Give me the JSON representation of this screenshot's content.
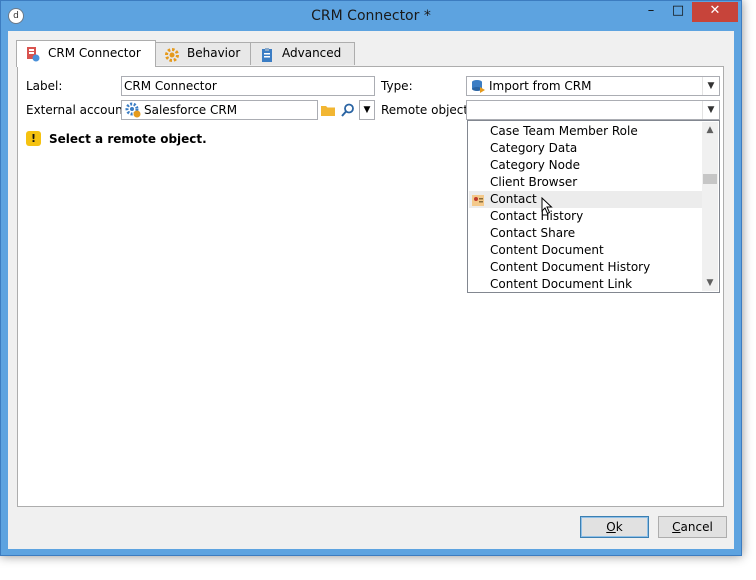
{
  "window": {
    "title": "CRM Connector *"
  },
  "title_buttons": {
    "minimize": "–",
    "maximize": "□",
    "close": "✕"
  },
  "tabs": [
    {
      "label": "CRM Connector",
      "icon": "crm-connector-icon",
      "active": true
    },
    {
      "label": "Behavior",
      "icon": "gear-icon",
      "active": false
    },
    {
      "label": "Advanced",
      "icon": "clipboard-icon",
      "active": false
    }
  ],
  "form": {
    "label_caption": "Label:",
    "label_value": "CRM Connector",
    "type_caption": "Type:",
    "type_value": "Import from CRM",
    "external_account_caption": "External account:",
    "external_account_value": "Salesforce CRM",
    "remote_object_caption": "Remote object:",
    "remote_object_value": ""
  },
  "warning": {
    "text": "Select a remote object.",
    "icon": "warning-icon"
  },
  "dropdown": {
    "items": [
      "Case Team Member Role",
      "Category Data",
      "Category Node",
      "Client Browser",
      "Contact",
      "Contact History",
      "Contact Share",
      "Content Document",
      "Content Document History",
      "Content Document Link"
    ],
    "hovered_index": 4
  },
  "buttons": {
    "ok_first": "O",
    "ok_rest": "k",
    "cancel_first": "C",
    "cancel_rest": "ancel"
  },
  "colors": {
    "titlebar": "#5da3e0",
    "close": "#c7443a",
    "warning": "#f5c211"
  }
}
